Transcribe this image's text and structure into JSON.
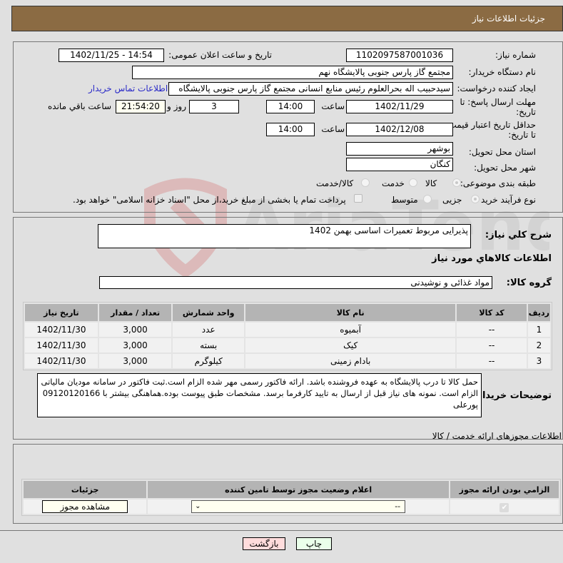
{
  "header": {
    "title": "جزئیات اطلاعات نیاز"
  },
  "form": {
    "need_number_label": "شماره نیاز:",
    "need_number": "1102097587001036",
    "announce_label": "تاریخ و ساعت اعلان عمومی:",
    "announce_value": "1402/11/25 - 14:54",
    "buyer_org_label": "نام دستگاه خریدار:",
    "buyer_org": "مجتمع گاز پارس جنوبی  پالایشگاه نهم",
    "creator_label": "ایجاد کننده درخواست:",
    "creator": "سیدحبیب اله بحرالعلوم رئیس منابع انسانی مجتمع گاز پارس جنوبی  پالایشگاه",
    "buyer_contact_link": "اطلاعات تماس خریدار",
    "reply_deadline_label": "مهلت ارسال پاسخ: تا تاریخ:",
    "reply_date": "1402/11/29",
    "time_label": "ساعت",
    "reply_time": "14:00",
    "days_value": "3",
    "days_label": "روز و",
    "remaining_time": "21:54:20",
    "remaining_label": "ساعت باقي مانده",
    "price_validity_label": "حداقل تاریخ اعتبار قیمت: تا تاریخ:",
    "price_date": "1402/12/08",
    "price_time": "14:00",
    "province_label": "استان محل تحویل:",
    "province": "بوشهر",
    "city_label": "شهر محل تحویل:",
    "city": "کنگان",
    "category_label": "طبقه بندی موضوعی:",
    "category_options": [
      "کالا",
      "خدمت",
      "کالا/خدمت"
    ],
    "category_selected": "کالا",
    "process_label": "نوع فرآیند خرید :",
    "process_options": [
      "جزیی",
      "متوسط"
    ],
    "process_selected": "جزیی",
    "treasury_note": "پرداخت تمام یا بخشی از مبلغ خرید،از محل \"اسناد خزانه اسلامی\" خواهد بود."
  },
  "description": {
    "label": "شرح کلي نیاز:",
    "value": "پذیرایی مربوط تعمیرات اساسی بهمن 1402"
  },
  "goods": {
    "section_title": "اطلاعات کالاهاي مورد نیاز",
    "group_label": "گروه کالا:",
    "group_value": "مواد غذائی و نوشیدنی",
    "columns": [
      "ردیف",
      "کد کالا",
      "نام کالا",
      "واحد شمارش",
      "تعداد / مقدار",
      "تاریخ نیاز"
    ],
    "rows": [
      {
        "index": "1",
        "code": "--",
        "name": "آبمیوه",
        "unit": "عدد",
        "qty": "3,000",
        "date": "1402/11/30"
      },
      {
        "index": "2",
        "code": "--",
        "name": "کیک",
        "unit": "بسته",
        "qty": "3,000",
        "date": "1402/11/30"
      },
      {
        "index": "3",
        "code": "--",
        "name": "بادام زمینی",
        "unit": "کیلوگرم",
        "qty": "3,000",
        "date": "1402/11/30"
      }
    ]
  },
  "buyer_notes": {
    "label": "توضیحات خریدار:",
    "value": "حمل کالا تا درب پالایشگاه به عهده فروشنده باشد. ارائه فاکتور رسمی مهر شده الزام است.ثبت فاکتور در سامانه مودیان مالیاتی الزام است. نمونه های نیاز قبل از ارسال به تایید کارفرما برسد. مشخصات طبق پیوست بوده.هماهنگی بیشتر با 09120120166 پورعلی"
  },
  "permits": {
    "section_title": "اطلاعات مجوزهای ارائه خدمت / کالا",
    "columns": [
      "الزامي بودن ارائه مجوز",
      "اعلام وضعیت مجوز توسط تامین کننده",
      "جزئیات"
    ],
    "row": {
      "required_checked": true,
      "status_selected": "--",
      "details_button": "مشاهده مجوز"
    }
  },
  "footer": {
    "print_button": "چاپ",
    "back_button": "بازگشت"
  },
  "colors": {
    "header_bg": "#8b6b43",
    "link": "#2a2ac8",
    "print_bg": "#eaffea",
    "back_bg": "#ffdcdc"
  }
}
